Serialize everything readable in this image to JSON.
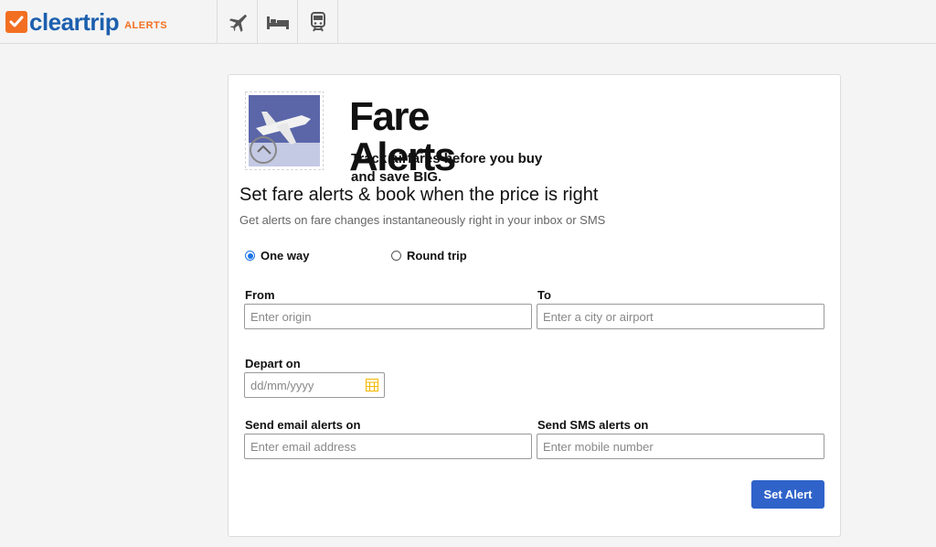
{
  "brand": {
    "name": "cleartrip",
    "sub": "ALERTS",
    "accent": "#f26f21",
    "brand_blue": "#1c5fae"
  },
  "nav": [
    {
      "icon": "airplane-icon"
    },
    {
      "icon": "hotel-bed-icon"
    },
    {
      "icon": "train-icon"
    }
  ],
  "hero": {
    "title": "Fare Alerts",
    "tagline_line1": "Track airfares before you buy",
    "tagline_line2": "and save BIG."
  },
  "headline": "Set fare alerts & book when the price is right",
  "subline": "Get alerts on fare changes instantaneously right in your inbox or SMS",
  "trip_type": {
    "one_way": "One way",
    "round_trip": "Round trip",
    "selected": "one_way"
  },
  "form": {
    "from_label": "From",
    "from_placeholder": "Enter origin",
    "to_label": "To",
    "to_placeholder": "Enter a city or airport",
    "depart_label": "Depart on",
    "depart_placeholder": "dd/mm/yyyy",
    "email_label": "Send email alerts on",
    "email_placeholder": "Enter email address",
    "sms_label": "Send SMS alerts on",
    "sms_placeholder": "Enter mobile number"
  },
  "submit_label": "Set Alert",
  "colors": {
    "button": "#2f63c9",
    "radio_selected": "#1a73e8",
    "calendar_icon": "#f5b700"
  }
}
